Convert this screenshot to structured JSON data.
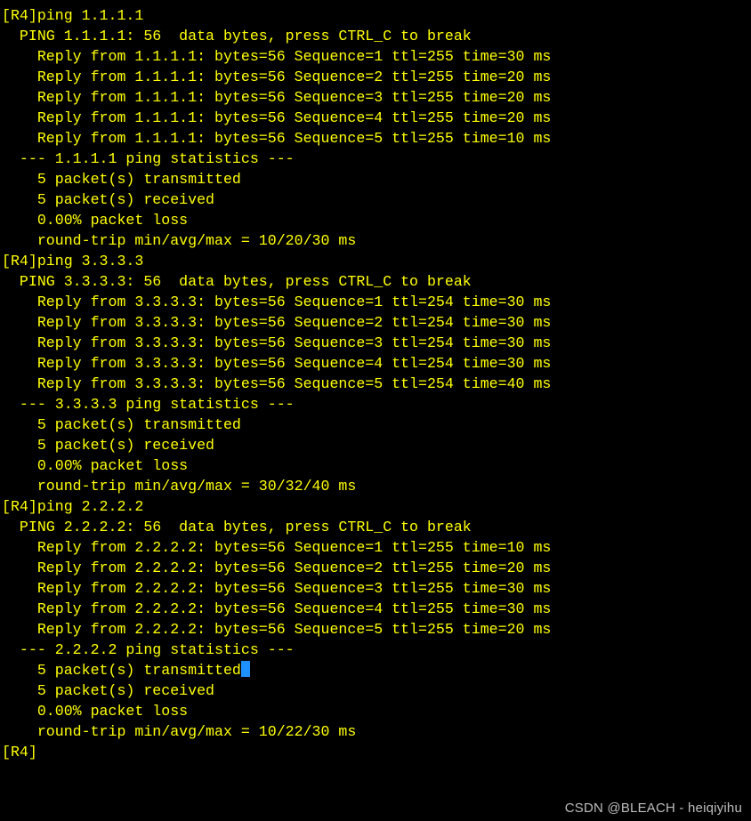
{
  "watermark": "CSDN @BLEACH - heiqiyihu",
  "prompt_host": "[R4]",
  "pings": [
    {
      "command": "ping 1.1.1.1",
      "header": "  PING 1.1.1.1: 56  data bytes, press CTRL_C to break",
      "replies": [
        "    Reply from 1.1.1.1: bytes=56 Sequence=1 ttl=255 time=30 ms",
        "    Reply from 1.1.1.1: bytes=56 Sequence=2 ttl=255 time=20 ms",
        "    Reply from 1.1.1.1: bytes=56 Sequence=3 ttl=255 time=20 ms",
        "    Reply from 1.1.1.1: bytes=56 Sequence=4 ttl=255 time=20 ms",
        "    Reply from 1.1.1.1: bytes=56 Sequence=5 ttl=255 time=10 ms"
      ],
      "stats_header": "  --- 1.1.1.1 ping statistics ---",
      "stats": [
        "    5 packet(s) transmitted",
        "    5 packet(s) received",
        "    0.00% packet loss",
        "    round-trip min/avg/max = 10/20/30 ms"
      ],
      "cursor_after_stat_index": null
    },
    {
      "command": "ping 3.3.3.3",
      "header": "  PING 3.3.3.3: 56  data bytes, press CTRL_C to break",
      "replies": [
        "    Reply from 3.3.3.3: bytes=56 Sequence=1 ttl=254 time=30 ms",
        "    Reply from 3.3.3.3: bytes=56 Sequence=2 ttl=254 time=30 ms",
        "    Reply from 3.3.3.3: bytes=56 Sequence=3 ttl=254 time=30 ms",
        "    Reply from 3.3.3.3: bytes=56 Sequence=4 ttl=254 time=30 ms",
        "    Reply from 3.3.3.3: bytes=56 Sequence=5 ttl=254 time=40 ms"
      ],
      "stats_header": "  --- 3.3.3.3 ping statistics ---",
      "stats": [
        "    5 packet(s) transmitted",
        "    5 packet(s) received",
        "    0.00% packet loss",
        "    round-trip min/avg/max = 30/32/40 ms"
      ],
      "cursor_after_stat_index": null
    },
    {
      "command": "ping 2.2.2.2",
      "header": "  PING 2.2.2.2: 56  data bytes, press CTRL_C to break",
      "replies": [
        "    Reply from 2.2.2.2: bytes=56 Sequence=1 ttl=255 time=10 ms",
        "    Reply from 2.2.2.2: bytes=56 Sequence=2 ttl=255 time=20 ms",
        "    Reply from 2.2.2.2: bytes=56 Sequence=3 ttl=255 time=30 ms",
        "    Reply from 2.2.2.2: bytes=56 Sequence=4 ttl=255 time=30 ms",
        "    Reply from 2.2.2.2: bytes=56 Sequence=5 ttl=255 time=20 ms"
      ],
      "stats_header": "  --- 2.2.2.2 ping statistics ---",
      "stats": [
        "    5 packet(s) transmitted",
        "    5 packet(s) received",
        "    0.00% packet loss",
        "    round-trip min/avg/max = 10/22/30 ms"
      ],
      "cursor_after_stat_index": 0
    }
  ],
  "final_prompt": "[R4]"
}
